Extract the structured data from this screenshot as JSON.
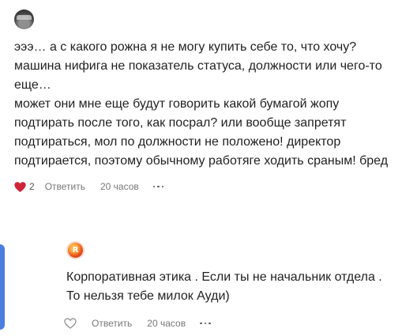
{
  "comments": [
    {
      "author": "",
      "text": "эээ… а с какого рожна я не могу купить себе то, что хочу? машина нифига не показатель статуса, должности или чего-то еще…\nможет они мне еще будут говорить какой бумагой жопу подтирать после того, как посрал? или вообще запретят подтираться, мол по должности не положено! директор подтирается, поэтому обычному работяге ходить сраным! бред",
      "likes": "2",
      "liked": true,
      "reply_label": "Ответить",
      "time": "20 часов"
    },
    {
      "author": "",
      "avatar_letter": "R",
      "text": "Корпоративная этика . Если ты не начальник отдела . То нельзя тебе милок Ауди)",
      "likes": "",
      "liked": false,
      "reply_label": "Ответить",
      "time": "20 часов"
    }
  ],
  "colors": {
    "like_active": "#d0243a",
    "accent": "#4a7fe0"
  }
}
